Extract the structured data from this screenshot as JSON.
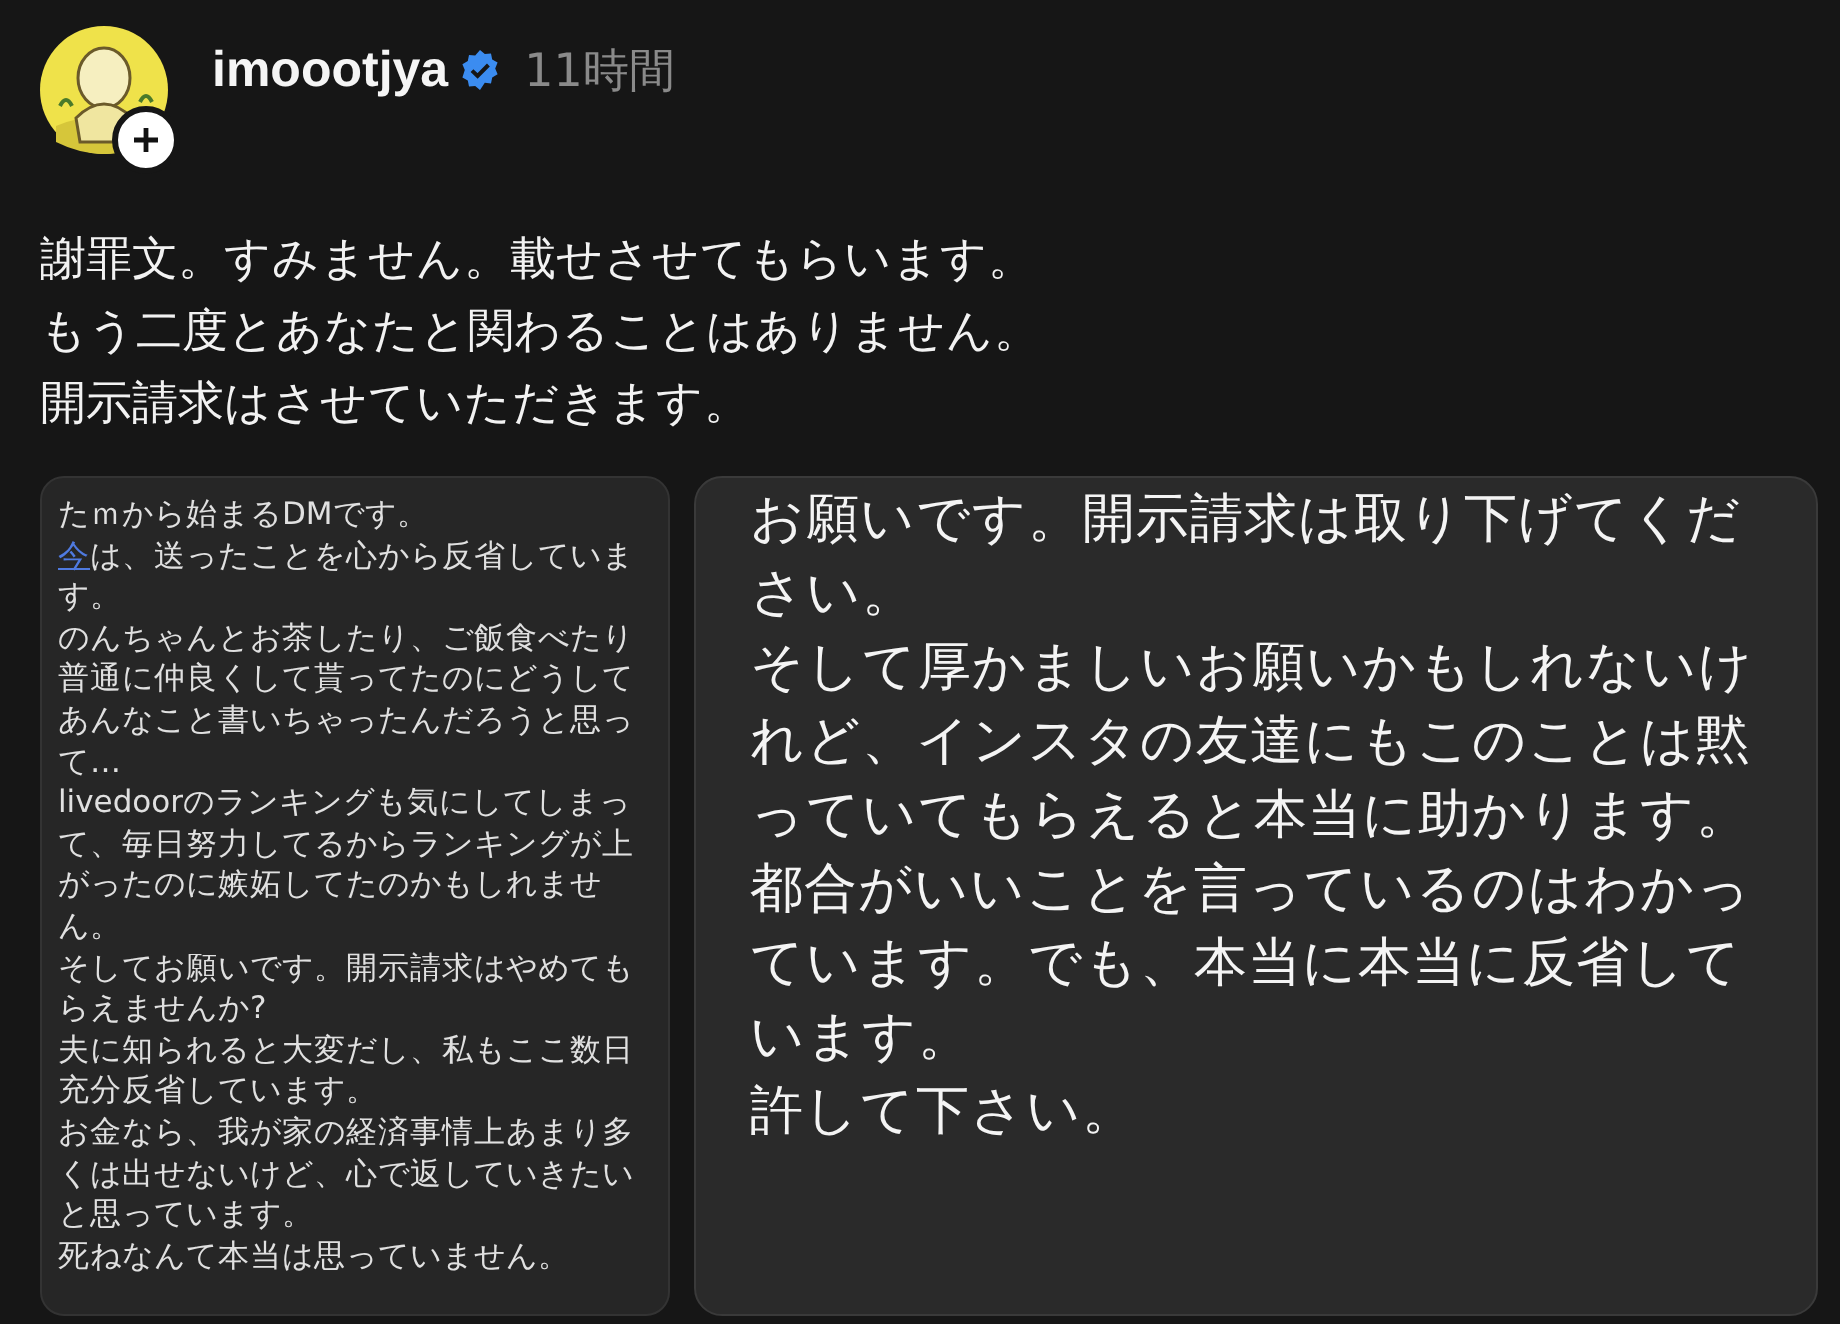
{
  "post": {
    "username": "imoootjya",
    "verified": true,
    "time": "11時間"
  },
  "caption": [
    "謝罪文。すみません。載せさせてもらいます。",
    "もう二度とあなたと関わることはありません。",
    "開示請求はさせていただきます。"
  ],
  "images": [
    {
      "paragraphs": [
        {
          "text": "たｍから始まるDMです。"
        },
        {
          "link": "今",
          "text": "は、送ったことを心から反省しています。"
        },
        {
          "text": "のんちゃんとお茶したり、ご飯食べたり普通に仲良くして貰ってたのにどうしてあんなこと書いちゃったんだろうと思って…"
        },
        {
          "text": "livedoorのランキングも気にしてしまって、毎日努力してるからランキングが上がったのに嫉妬してたのかもしれません。"
        },
        {
          "text": "そしてお願いです。開示請求はやめてもらえませんか?"
        },
        {
          "text": "夫に知られると大変だし、私もここ数日充分反省しています。"
        },
        {
          "text": "お金なら、我が家の経済事情上あまり多くは出せないけど、心で返していきたいと思っています。"
        },
        {
          "text": "死ねなんて本当は思っていません。"
        }
      ]
    },
    {
      "paragraphs": [
        {
          "text": "お願いです。開示請求は取り下げてください。"
        },
        {
          "text": "そして厚かましいお願いかもしれないけれど、インスタの友達にもこのことは黙っていてもらえると本当に助かります。"
        },
        {
          "text": "都合がいいことを言っているのはわかっています。でも、本当に本当に反省しています。"
        },
        {
          "text": "許して下さい。"
        }
      ]
    }
  ]
}
